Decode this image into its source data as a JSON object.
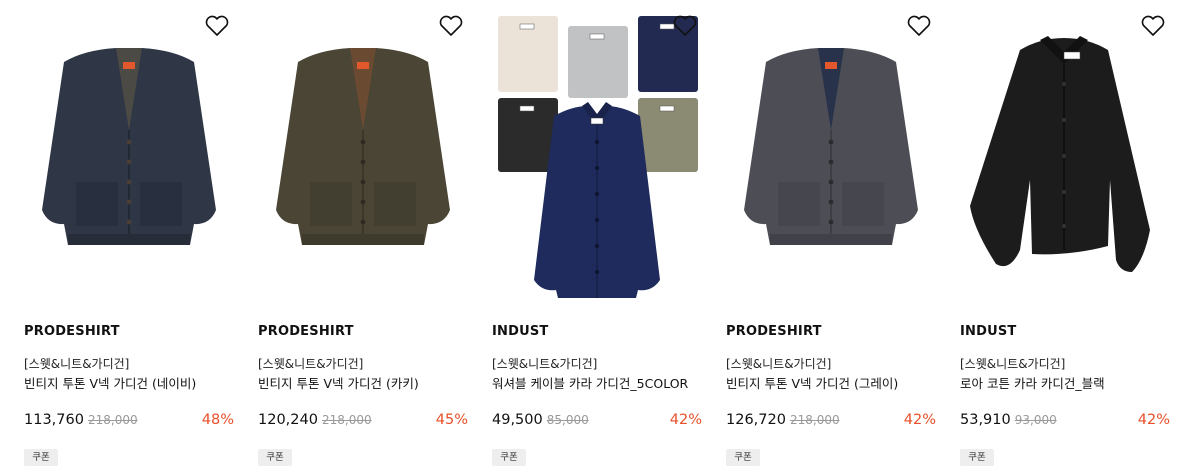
{
  "products": [
    {
      "brand": "PRODESHIRT",
      "category": "[스웻&니트&가디건]",
      "name": "빈티지 투톤 V넥 가디건 (네이비)",
      "price": "113,760",
      "original_price": "218,000",
      "discount": "48%",
      "badge": "쿠폰",
      "image": {
        "type": "vneck-cardigan",
        "body_color": "#2f3646",
        "inner_color": "#4c4a45"
      }
    },
    {
      "brand": "PRODESHIRT",
      "category": "[스웻&니트&가디건]",
      "name": "빈티지 투톤 V넥 가디건 (카키)",
      "price": "120,240",
      "original_price": "218,000",
      "discount": "45%",
      "badge": "쿠폰",
      "image": {
        "type": "vneck-cardigan",
        "body_color": "#4a4534",
        "inner_color": "#6b4a32"
      }
    },
    {
      "brand": "INDUST",
      "category": "[스웻&니트&가디건]",
      "name": "워셔블 케이블 카라 가디건_5COLOR",
      "price": "49,500",
      "original_price": "85,000",
      "discount": "42%",
      "badge": "쿠폰",
      "image": {
        "type": "multicolor-collar-cardigan",
        "main_color": "#1e2b5c",
        "variants": [
          "#ece3d8",
          "#c0c2c4",
          "#222a52",
          "#2b2b2b",
          "#8b8a72"
        ]
      }
    },
    {
      "brand": "PRODESHIRT",
      "category": "[스웻&니트&가디건]",
      "name": "빈티지 투톤 V넥 가디건 (그레이)",
      "price": "126,720",
      "original_price": "218,000",
      "discount": "42%",
      "badge": "쿠폰",
      "image": {
        "type": "vneck-cardigan",
        "body_color": "#4d4e55",
        "inner_color": "#28324a"
      }
    },
    {
      "brand": "INDUST",
      "category": "[스웻&니트&가디건]",
      "name": "로아 코튼 카라 카디건_블랙",
      "price": "53,910",
      "original_price": "93,000",
      "discount": "42%",
      "badge": "쿠폰",
      "image": {
        "type": "collar-cardigan",
        "body_color": "#1c1c1c"
      }
    }
  ],
  "icons": {
    "wishlist": "heart-outline-icon"
  },
  "colors": {
    "discount": "#e8502a",
    "original_price": "#9a9a9a",
    "badge_bg": "#eeeeee"
  }
}
